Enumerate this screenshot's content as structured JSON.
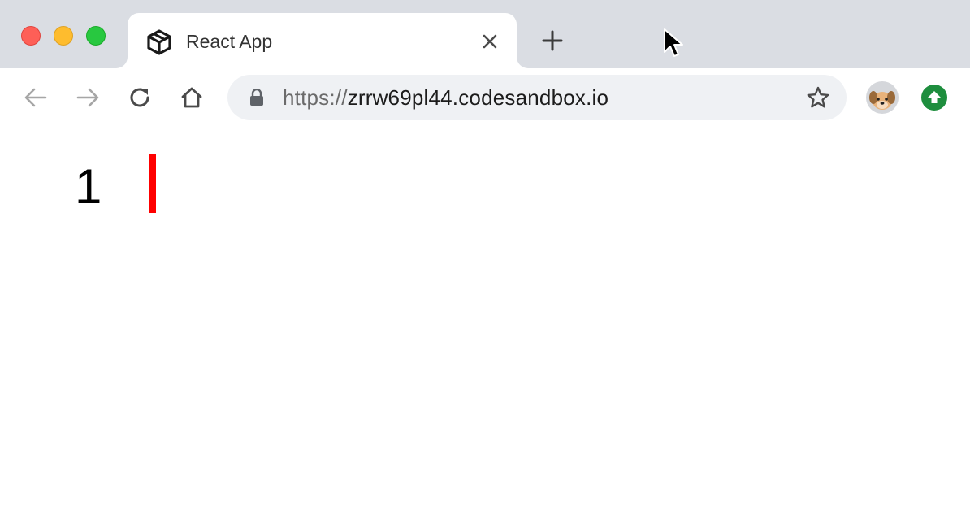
{
  "tab": {
    "title": "React App",
    "favicon": "codesandbox-cube-icon"
  },
  "toolbar": {
    "url_scheme": "https://",
    "url_host": "zrrw69pl44.codesandbox.io"
  },
  "page": {
    "counter": "1",
    "bar_color": "#ff0000"
  },
  "colors": {
    "tabstrip_bg": "#dadde3",
    "omnibox_bg": "#eff1f4",
    "update_green": "#1e8e3e",
    "traffic_close": "#fe5f57",
    "traffic_minimize": "#febc2e",
    "traffic_maximize": "#28c840"
  }
}
